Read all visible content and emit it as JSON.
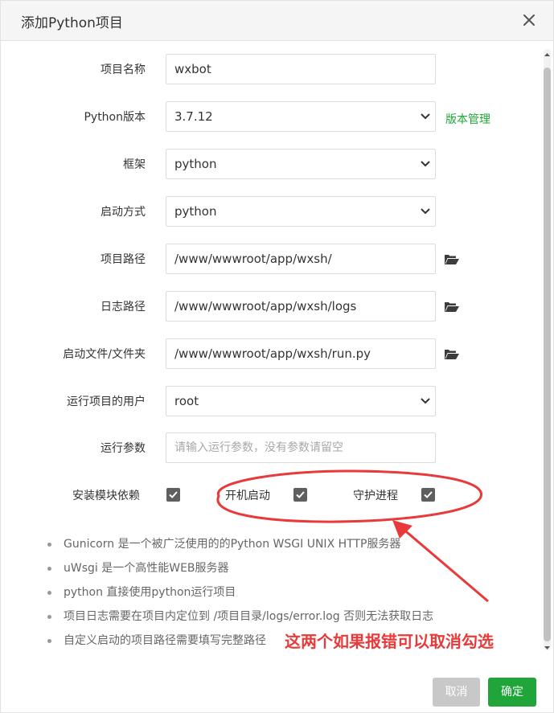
{
  "dialog": {
    "title": "添加Python项目",
    "close_icon": "close-icon"
  },
  "form": {
    "project_name": {
      "label": "项目名称",
      "value": "wxbot"
    },
    "python_version": {
      "label": "Python版本",
      "value": "3.7.12",
      "link": "版本管理"
    },
    "framework": {
      "label": "框架",
      "value": "python"
    },
    "start_mode": {
      "label": "启动方式",
      "value": "python"
    },
    "project_path": {
      "label": "项目路径",
      "value": "/www/wwwroot/app/wxsh/"
    },
    "log_path": {
      "label": "日志路径",
      "value": "/www/wwwroot/app/wxsh/logs"
    },
    "start_file": {
      "label": "启动文件/文件夹",
      "value": "/www/wwwroot/app/wxsh/run.py"
    },
    "run_user": {
      "label": "运行项目的用户",
      "value": "root"
    },
    "run_params": {
      "label": "运行参数",
      "placeholder": "请输入运行参数，没有参数请留空"
    },
    "install_deps": {
      "label": "安装模块依赖",
      "checked": true
    },
    "autostart": {
      "label": "开机启动",
      "checked": true
    },
    "daemon": {
      "label": "守护进程",
      "checked": true
    }
  },
  "tips": [
    "Gunicorn 是一个被广泛使用的的Python WSGI UNIX HTTP服务器",
    "uWsgi 是一个高性能WEB服务器",
    "python 直接使用python运行项目",
    "项目日志需要在项目内定位到 /项目目录/logs/error.log 否则无法获取日志",
    "自定义启动的项目路径需要填写完整路径"
  ],
  "annotation": {
    "text": "这两个如果报错可以取消勾选",
    "color": "#e83a3a"
  },
  "footer": {
    "cancel_label": "取消",
    "ok_label": "确定"
  },
  "colors": {
    "accent": "#20a53a",
    "annotation": "#e83a3a",
    "checkbox": "#5f5f5f"
  },
  "icons": {
    "folder": "folder-open-icon",
    "select": "chevron-down-icon",
    "check": "check-icon"
  }
}
